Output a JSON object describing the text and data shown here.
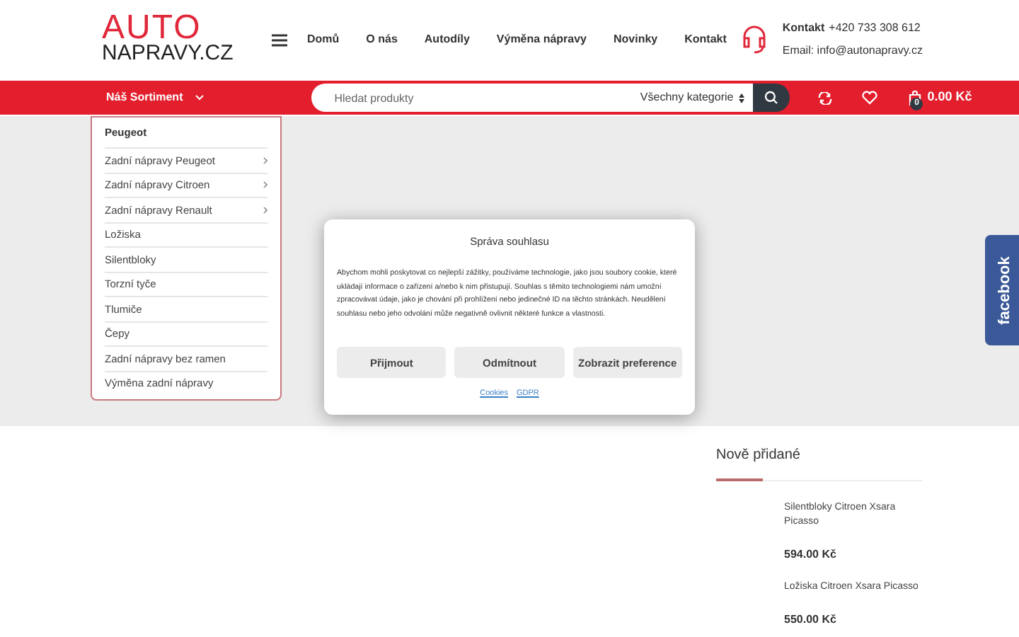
{
  "logo": {
    "line1": "AUTO",
    "line2": "NAPRAVY.CZ"
  },
  "nav": [
    "Domů",
    "O nás",
    "Autodíly",
    "Výměna nápravy",
    "Novinky",
    "Kontakt"
  ],
  "contact": {
    "label": "Kontakt",
    "phone": "+420 733 308 612",
    "email": "Email: info@autonapravy.cz"
  },
  "bar": {
    "assortment": "Náš Sortiment",
    "search_placeholder": "Hledat produkty",
    "category": "Všechny kategorie",
    "cart_total": "0.00 Kč",
    "cart_count": "0"
  },
  "menu": {
    "heading": "Peugeot",
    "items": [
      {
        "label": "Zadní nápravy Peugeot",
        "has_submenu": true
      },
      {
        "label": "Zadní nápravy Citroen",
        "has_submenu": true
      },
      {
        "label": "Zadní nápravy Renault",
        "has_submenu": true
      },
      {
        "label": "Ložiska",
        "has_submenu": false
      },
      {
        "label": "Silentbloky",
        "has_submenu": false
      },
      {
        "label": "Torzní tyče",
        "has_submenu": false
      },
      {
        "label": "Tlumiče",
        "has_submenu": false
      },
      {
        "label": "Čepy",
        "has_submenu": false
      },
      {
        "label": "Zadní nápravy bez ramen",
        "has_submenu": false
      },
      {
        "label": "Výměna zadní nápravy",
        "has_submenu": false
      }
    ]
  },
  "consent": {
    "title": "Správa souhlasu",
    "text": "Abychom mohli poskytovat co nejlepší zážitky, používáme technologie, jako jsou soubory cookie, které ukládají informace o zařízení a/nebo k nim přistupují. Souhlas s těmito technologiemi nám umožní zpracovávat údaje, jako je chování při prohlížení nebo jedinečné ID na těchto stránkách. Neudělení souhlasu nebo jeho odvolání může negativně ovlivnit některé funkce a vlastnosti.",
    "buttons": [
      "Přijmout",
      "Odmítnout",
      "Zobrazit preference"
    ],
    "links": [
      "Cookies",
      "GDPR"
    ]
  },
  "facebook": "facebook",
  "new_products": {
    "title": "Nově přidané",
    "items": [
      {
        "name": "Silentbloky Citroen Xsara Picasso",
        "price": "594.00 Kč"
      },
      {
        "name": "Ložiska Citroen Xsara Picasso",
        "price": "550.00 Kč"
      }
    ]
  }
}
